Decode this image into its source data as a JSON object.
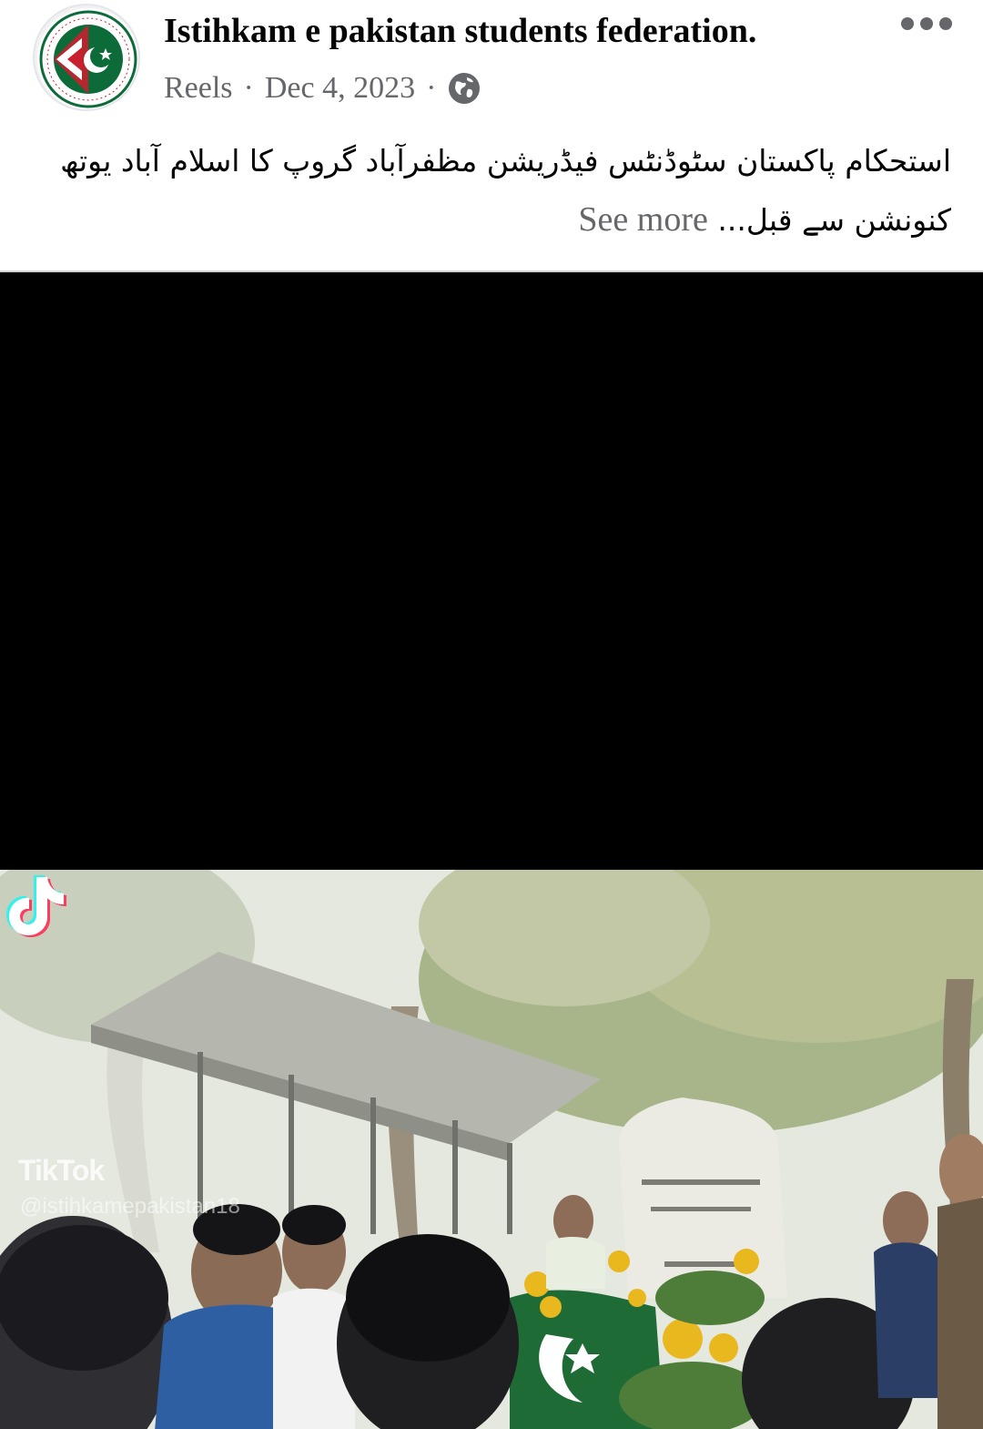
{
  "post": {
    "author_name": "Istihkam e pakistan students federation.",
    "avatar_logo_text": "Istihkam e pakistan students federation",
    "avatar_motto": "Respect · Unity · Morality",
    "source": "Reels",
    "separator": "·",
    "date": "Dec 4, 2023",
    "privacy_icon": "globe-icon",
    "menu_icon": "more-options-icon"
  },
  "caption": {
    "text": "استحکام پاکستان سٹوڈنٹس فیڈریشن مظفرآباد گروپ کا اسلام آباد یوتھ کنونشن سے قبل...",
    "see_more": "See more"
  },
  "video": {
    "watermark_brand": "TikTok",
    "watermark_handle": "@istihkamepakistan18"
  },
  "colors": {
    "text_primary": "#050505",
    "text_secondary": "#65676b",
    "video_background": "#000000",
    "logo_green": "#0d6b3a",
    "logo_red": "#c8202f"
  }
}
